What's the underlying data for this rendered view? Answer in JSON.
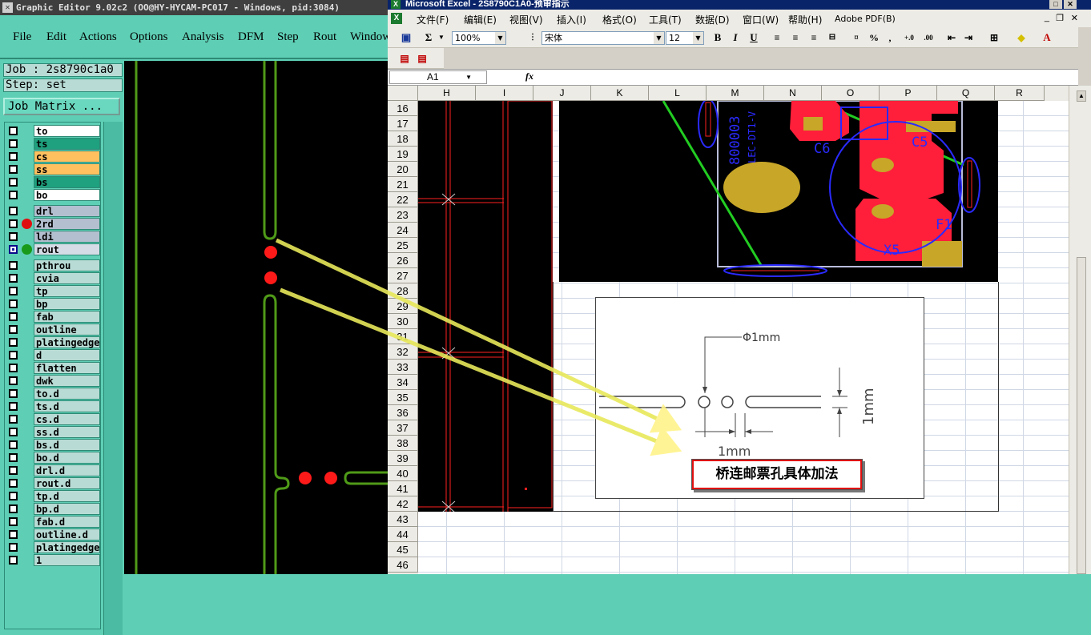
{
  "graphic_editor": {
    "title": "Graphic Editor 9.02c2 (OO@HY-HYCAM-PC017 - Windows, pid:3084)",
    "menu": [
      "File",
      "Edit",
      "Actions",
      "Options",
      "Analysis",
      "DFM",
      "Step",
      "Rout",
      "Window"
    ],
    "job_label": "Job : 2s8790c1a0",
    "step_label": "Step: set",
    "job_matrix_label": "Job Matrix ...",
    "layers": [
      {
        "name": "to",
        "color": "#ffffff"
      },
      {
        "name": "ts",
        "color": "#1fa07e"
      },
      {
        "name": "cs",
        "color": "#ffc060"
      },
      {
        "name": "ss",
        "color": "#ffc060"
      },
      {
        "name": "bs",
        "color": "#1fa07e"
      },
      {
        "name": "bo",
        "color": "#ffffff"
      },
      {
        "name": "drl",
        "color": "#b3bfcf"
      },
      {
        "name": "2rd",
        "color": "#b3bfcf",
        "dot": "#e01010"
      },
      {
        "name": "ldi",
        "color": "#b3bfcf"
      },
      {
        "name": "rout",
        "color": "#d6dce6",
        "dot": "#1a9a1a",
        "active": true
      },
      {
        "name": "pthrou",
        "color": "#b8dcd5"
      },
      {
        "name": "cvia",
        "color": "#b8dcd5"
      },
      {
        "name": "tp",
        "color": "#b8dcd5"
      },
      {
        "name": "bp",
        "color": "#b8dcd5"
      },
      {
        "name": "fab",
        "color": "#b8dcd5"
      },
      {
        "name": "outline",
        "color": "#b8dcd5"
      },
      {
        "name": "platingedge",
        "color": "#b8dcd5"
      },
      {
        "name": "d",
        "color": "#b8dcd5"
      },
      {
        "name": "flatten",
        "color": "#b8dcd5"
      },
      {
        "name": "dwk",
        "color": "#b8dcd5"
      },
      {
        "name": "to.d",
        "color": "#b8dcd5"
      },
      {
        "name": "ts.d",
        "color": "#b8dcd5"
      },
      {
        "name": "cs.d",
        "color": "#b8dcd5"
      },
      {
        "name": "ss.d",
        "color": "#b8dcd5"
      },
      {
        "name": "bs.d",
        "color": "#b8dcd5"
      },
      {
        "name": "bo.d",
        "color": "#b8dcd5"
      },
      {
        "name": "drl.d",
        "color": "#b8dcd5"
      },
      {
        "name": "rout.d",
        "color": "#b8dcd5"
      },
      {
        "name": "tp.d",
        "color": "#b8dcd5"
      },
      {
        "name": "bp.d",
        "color": "#b8dcd5"
      },
      {
        "name": "fab.d",
        "color": "#b8dcd5"
      },
      {
        "name": "outline.d",
        "color": "#b8dcd5"
      },
      {
        "name": "platingedge",
        "color": "#b8dcd5"
      },
      {
        "name": "1",
        "color": "#b8dcd5"
      }
    ]
  },
  "excel": {
    "title": "Microsoft Excel - 2S8790C1A0-预审指示",
    "menu": [
      "文件(F)",
      "编辑(E)",
      "视图(V)",
      "插入(I)",
      "格式(O)",
      "工具(T)",
      "数据(D)",
      "窗口(W)",
      "帮助(H)",
      "Adobe PDF(B)"
    ],
    "zoom": "100%",
    "font_name": "宋体",
    "font_size": "12",
    "name_box": "A1",
    "fx_label": "fx",
    "columns": [
      "H",
      "I",
      "J",
      "K",
      "L",
      "M",
      "N",
      "O",
      "P",
      "Q",
      "R"
    ],
    "rows": [
      "16",
      "17",
      "18",
      "19",
      "20",
      "21",
      "22",
      "23",
      "24",
      "25",
      "26",
      "27",
      "28",
      "29",
      "30",
      "31",
      "32",
      "33",
      "34",
      "35",
      "36",
      "37",
      "38",
      "39",
      "40",
      "41",
      "42",
      "43",
      "44",
      "45",
      "46"
    ],
    "pcb_silkscreen": [
      "800003",
      "LEC-DT1-V",
      "C6",
      "C5",
      "F1",
      "X5"
    ],
    "diagram": {
      "hole_dim": "Φ1mm",
      "gap_dim": "1mm",
      "height_dim": "1mm",
      "label": "桥连邮票孔具体加法"
    }
  }
}
